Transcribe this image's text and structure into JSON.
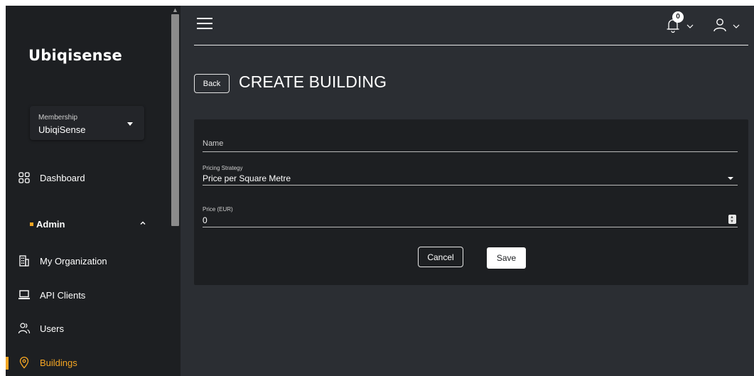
{
  "brand": {
    "name": "Ubiqisense"
  },
  "membership": {
    "label": "Membership",
    "value": "UbiqiSense"
  },
  "sidebar": {
    "dashboard": {
      "label": "Dashboard",
      "icon": "grid-icon"
    },
    "admin": {
      "label": "Admin",
      "expanded": true
    },
    "items": [
      {
        "label": "My Organization",
        "icon": "building-icon"
      },
      {
        "label": "API Clients",
        "icon": "laptop-icon"
      },
      {
        "label": "Users",
        "icon": "users-icon"
      },
      {
        "label": "Buildings",
        "icon": "location-pin-icon",
        "active": true
      }
    ]
  },
  "header": {
    "notification_count": "0"
  },
  "page": {
    "back_label": "Back",
    "title": "CREATE BUILDING"
  },
  "form": {
    "name": {
      "label": "Name",
      "value": ""
    },
    "pricing_strategy": {
      "label": "Pricing Strategy",
      "value": "Price per Square Metre"
    },
    "price": {
      "label": "Price (EUR)",
      "value": "0"
    },
    "cancel_label": "Cancel",
    "save_label": "Save"
  },
  "colors": {
    "accent": "#f5a623",
    "sidebar_bg": "#1d1f22",
    "main_bg": "#2b2e33",
    "card_bg": "#1d1f22"
  }
}
